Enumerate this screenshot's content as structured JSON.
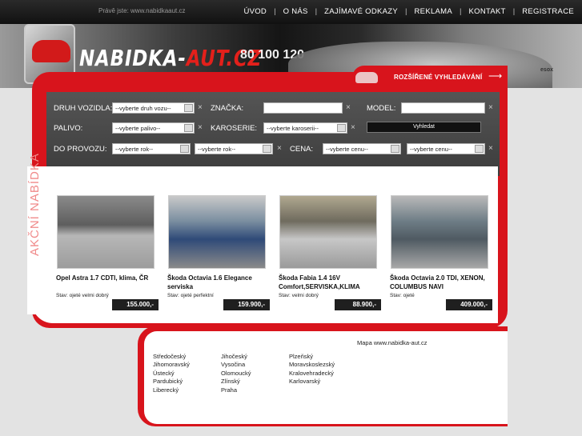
{
  "topbar": {
    "viewing": "Právě jste: www.nabidkaaut.cz",
    "nav": [
      "ÚVOD",
      "O NÁS",
      "ZAJÍMAVÉ ODKAZY",
      "REKLAMA",
      "KONTAKT",
      "REGISTRACE"
    ]
  },
  "header": {
    "logo_main": "NABIDKA-",
    "logo_accent": "AUT.CZ",
    "speedo": "80  100  120",
    "esox": "esox"
  },
  "search": {
    "advanced_link": "ROZŠÍŘENÉ VYHLEDÁVÁNÍ"
  },
  "form": {
    "vehicle_type_label": "DRUH VOZIDLA:",
    "vehicle_type_value": "--vyberte druh vozu--",
    "brand_label": "ZNAČKA:",
    "model_label": "MODEL:",
    "fuel_label": "PALIVO:",
    "fuel_value": "--vyberte palivo--",
    "body_label": "KAROSERIE:",
    "body_value": "--vyberte karoserii--",
    "search_button": "Vyhledat",
    "year_label": "DO PROVOZU:",
    "year_from": "--vyberte rok--",
    "year_to": "--vyberte rok--",
    "price_label": "CENA:",
    "price_from": "--vyberte cenu--",
    "price_to": "--vyberte cenu--",
    "clear": "×"
  },
  "offers": {
    "section_title": "AKČNÍ NABÍDKA",
    "items": [
      {
        "name": "Opel Astra 1.7 CDTI, klima, ČR",
        "state": "Stav: ojeté velmi dobrý",
        "price": "155.000,-"
      },
      {
        "name": "Škoda Octavia 1.6 Elegance serviska",
        "state": "Stav: ojeté perfektní",
        "price": "159.900,-"
      },
      {
        "name": "Škoda Fabia 1.4 16V Comfort,SERVISKA,KLIMA",
        "state": "Stav: velmi dobrý",
        "price": "88.900,-"
      },
      {
        "name": "Škoda Octavia 2.0 TDI, XENON, COLUMBUS NAVI",
        "state": "Stav: ojeté",
        "price": "409.000,-"
      }
    ]
  },
  "map": {
    "title": "Mapa www.nabidka-aut.cz",
    "col1": [
      "Středočeský",
      "Jihomoravský",
      "Ústecký",
      "Pardubický",
      "Liberecký"
    ],
    "col2": [
      "Jihočeský",
      "Vysočina",
      "Olomoucký",
      "Zlínský",
      "Praha"
    ],
    "col3": [
      "Plzeňský",
      "Moravskoslezský",
      "Kralovehradecký",
      "Karlovarský"
    ]
  },
  "colors": {
    "brand_red": "#d8141c",
    "dark": "#1f1f1f"
  }
}
